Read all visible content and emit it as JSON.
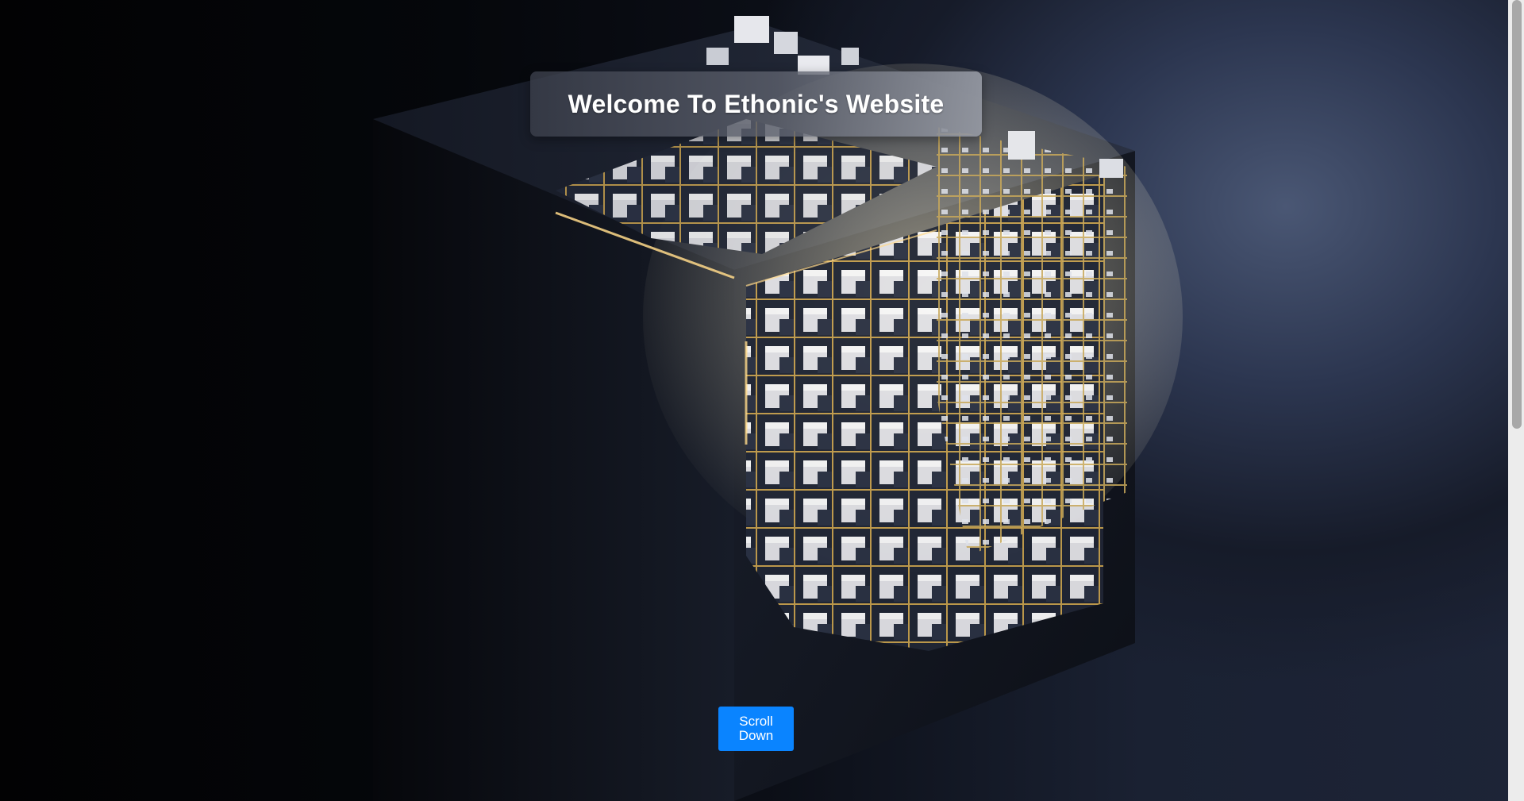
{
  "hero": {
    "title": "Welcome To Ethonic's Website",
    "background_image": "3d-cube-circuit-render",
    "accent_color": "#d9b86a"
  },
  "scroll_button": {
    "label": "Scroll Down",
    "color": "#0a84ff"
  },
  "scrollbar": {
    "visible": true
  }
}
